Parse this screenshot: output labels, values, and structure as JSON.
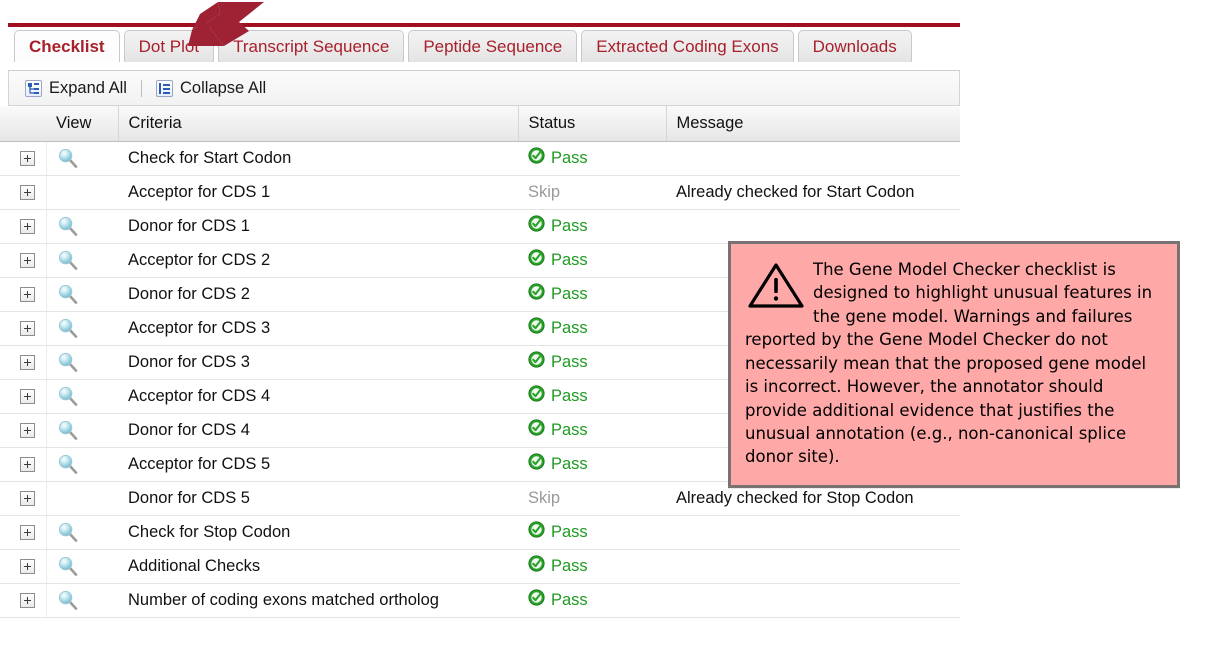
{
  "tabs": [
    {
      "label": "Checklist",
      "active": true
    },
    {
      "label": "Dot Plot",
      "active": false
    },
    {
      "label": "Transcript Sequence",
      "active": false
    },
    {
      "label": "Peptide Sequence",
      "active": false
    },
    {
      "label": "Extracted Coding Exons",
      "active": false
    },
    {
      "label": "Downloads",
      "active": false
    }
  ],
  "toolbar": {
    "expand_all_label": "Expand All",
    "collapse_all_label": "Collapse All",
    "expand_icon": "expand-tree-icon",
    "collapse_icon": "collapse-list-icon"
  },
  "table": {
    "headers": {
      "expander": "",
      "view": "View",
      "criteria": "Criteria",
      "status": "Status",
      "message": "Message"
    },
    "rows": [
      {
        "view_icon": "magnifier-icon",
        "has_view": true,
        "criteria": "Check for Start Codon",
        "status": "Pass",
        "status_kind": "pass",
        "message": ""
      },
      {
        "view_icon": "",
        "has_view": false,
        "criteria": "Acceptor for CDS 1",
        "status": "Skip",
        "status_kind": "skip",
        "message": "Already checked for Start Codon"
      },
      {
        "view_icon": "magnifier-icon",
        "has_view": true,
        "criteria": "Donor for CDS 1",
        "status": "Pass",
        "status_kind": "pass",
        "message": ""
      },
      {
        "view_icon": "magnifier-icon",
        "has_view": true,
        "criteria": "Acceptor for CDS 2",
        "status": "Pass",
        "status_kind": "pass",
        "message": ""
      },
      {
        "view_icon": "magnifier-icon",
        "has_view": true,
        "criteria": "Donor for CDS 2",
        "status": "Pass",
        "status_kind": "pass",
        "message": ""
      },
      {
        "view_icon": "magnifier-icon",
        "has_view": true,
        "criteria": "Acceptor for CDS 3",
        "status": "Pass",
        "status_kind": "pass",
        "message": ""
      },
      {
        "view_icon": "magnifier-icon",
        "has_view": true,
        "criteria": "Donor for CDS 3",
        "status": "Pass",
        "status_kind": "pass",
        "message": ""
      },
      {
        "view_icon": "magnifier-icon",
        "has_view": true,
        "criteria": "Acceptor for CDS 4",
        "status": "Pass",
        "status_kind": "pass",
        "message": ""
      },
      {
        "view_icon": "magnifier-icon",
        "has_view": true,
        "criteria": "Donor for CDS 4",
        "status": "Pass",
        "status_kind": "pass",
        "message": ""
      },
      {
        "view_icon": "magnifier-icon",
        "has_view": true,
        "criteria": "Acceptor for CDS 5",
        "status": "Pass",
        "status_kind": "pass",
        "message": ""
      },
      {
        "view_icon": "",
        "has_view": false,
        "criteria": "Donor for CDS 5",
        "status": "Skip",
        "status_kind": "skip",
        "message": "Already checked for Stop Codon"
      },
      {
        "view_icon": "magnifier-icon",
        "has_view": true,
        "criteria": "Check for Stop Codon",
        "status": "Pass",
        "status_kind": "pass",
        "message": ""
      },
      {
        "view_icon": "magnifier-icon",
        "has_view": true,
        "criteria": "Additional Checks",
        "status": "Pass",
        "status_kind": "pass",
        "message": ""
      },
      {
        "view_icon": "magnifier-icon",
        "has_view": true,
        "criteria": "Number of coding exons matched ortholog",
        "status": "Pass",
        "status_kind": "pass",
        "message": ""
      }
    ]
  },
  "warning": {
    "icon": "warning-triangle-icon",
    "text": "The Gene Model Checker checklist is designed to highlight unusual features in the gene model. Warnings and failures reported by the Gene Model Checker do not necessarily mean that the proposed gene model is incorrect. However, the annotator should provide additional evidence that justifies the unusual annotation (e.g., non-canonical splice donor site)."
  },
  "annotation": {
    "arrow": "red-arrow-pointing-to-dot-plot-tab"
  },
  "colors": {
    "tab_text": "#a8202c",
    "tab_rule": "#a01020",
    "pass_green": "#1f9b22",
    "skip_gray": "#999999",
    "warning_bg": "#ffa8a8",
    "warning_border": "#7a7272",
    "arrow_red": "#9e2233"
  }
}
